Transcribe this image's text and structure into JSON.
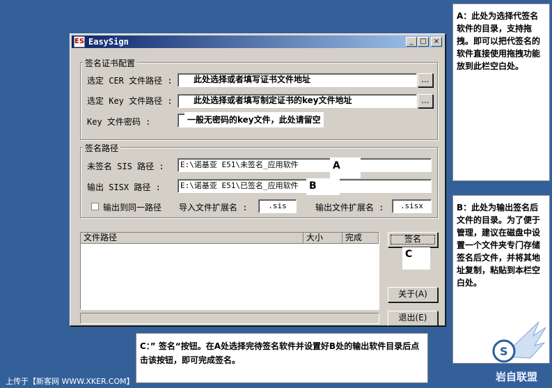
{
  "window": {
    "title": "EasySign",
    "icon_text": "ES",
    "minimize": "_",
    "maximize": "□",
    "close": "×"
  },
  "cert_group": {
    "title": "签名证书配置",
    "cer_label": "选定 CER 文件路径 :",
    "cer_value": "此处选择或者填写证书文件地址",
    "key_label": "选定 Key 文件路径 :",
    "key_value": "此处选择或者填写制定证书的key文件地址",
    "pwd_label": "Key 文件密码 :",
    "pwd_hint": "一般无密码的key文件，此处请留空",
    "browse": "..."
  },
  "path_group": {
    "title": "签名路径",
    "sis_label": "未签名 SIS 路径 :",
    "sis_value": "E:\\诺基亚 E51\\未签名_应用软件",
    "sisx_label": "输出 SISX 路径 :",
    "sisx_value": "E:\\诺基亚 E51\\已签名_应用软件",
    "same_path_label": "输出到同一路径",
    "import_ext_label": "导入文件扩展名 :",
    "import_ext_value": ".sis",
    "export_ext_label": "输出文件扩展名 :",
    "export_ext_value": ".sisx"
  },
  "file_list": {
    "columns": [
      "文件路径",
      "大小",
      "完成"
    ]
  },
  "buttons": {
    "sign": "签名",
    "about": "关于(A)",
    "exit": "退出(E)"
  },
  "annotations": {
    "a_tag": "A",
    "b_tag": "B",
    "c_tag": "C",
    "a_note": "A：此处为选择代签名软件的目录，支持拖拽。即可以把代签名的软件直接使用拖拽功能放到此栏空白处。",
    "b_note": "B：此处为输出签名后文件的目录。为了便于管理，建议在磁盘中设置一个文件夹专门存储签名后文件，并将其地址复制，粘贴到本栏空白处。",
    "c_note": "C：” 签名“按钮。在A处选择完待签名软件并设置好B处的输出软件目录后点击该按钮，即可完成签名。"
  },
  "footer": {
    "upload_text": "上传于【新客网 WWW.XKER.COM】",
    "logo_text": "岩自联盟"
  }
}
